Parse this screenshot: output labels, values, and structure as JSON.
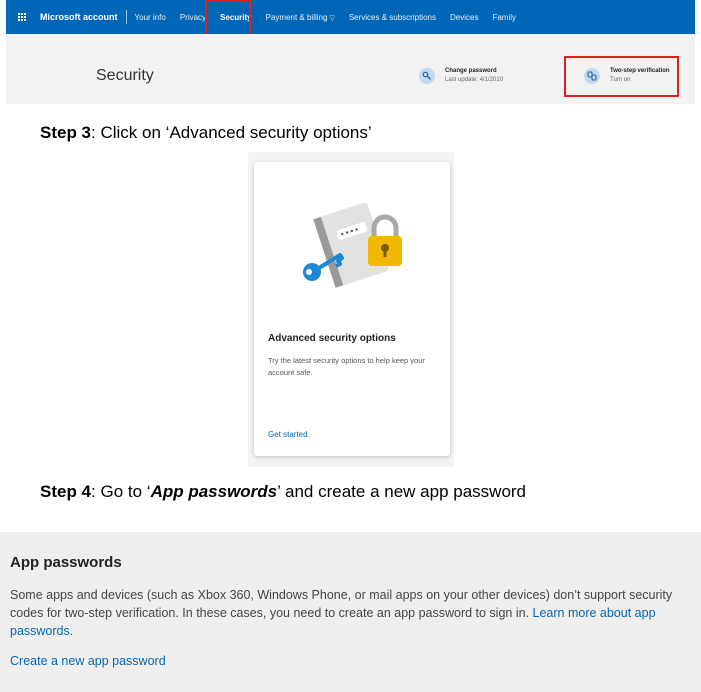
{
  "nav": {
    "brand": "Microsoft account",
    "items": [
      {
        "label": "Your info"
      },
      {
        "label": "Privacy"
      },
      {
        "label": "Security"
      },
      {
        "label": "Payment & billing"
      },
      {
        "label": "Services & subscriptions"
      },
      {
        "label": "Devices"
      },
      {
        "label": "Family"
      }
    ]
  },
  "banner": {
    "title": "Security",
    "change_password": {
      "title": "Change password",
      "subtitle": "Last update: 4/1/2010"
    },
    "two_step": {
      "title": "Two-step verification",
      "subtitle": "Turn on"
    }
  },
  "step3": {
    "prefix": "Step 3",
    "text": ": Click on ‘Advanced security options’"
  },
  "card": {
    "title": "Advanced security options",
    "description": "Try the latest security options to help keep your account safe.",
    "link": "Get started"
  },
  "step4": {
    "prefix": "Step 4",
    "text_before": ": Go to ‘",
    "emphasis": "App passwords",
    "text_after": "’ and create a new app password"
  },
  "app_passwords": {
    "title": "App passwords",
    "description": "Some apps and devices (such as Xbox 360, Windows Phone, or mail apps on your other devices) don’t support security codes for two-step verification. In these cases, you need to create an app password to sign in.",
    "learn_more": "Learn more about app passwords.",
    "create_link": "Create a new app password"
  },
  "colors": {
    "nav_bg": "#0067b8",
    "highlight": "#e02020",
    "link": "#0067b8"
  }
}
